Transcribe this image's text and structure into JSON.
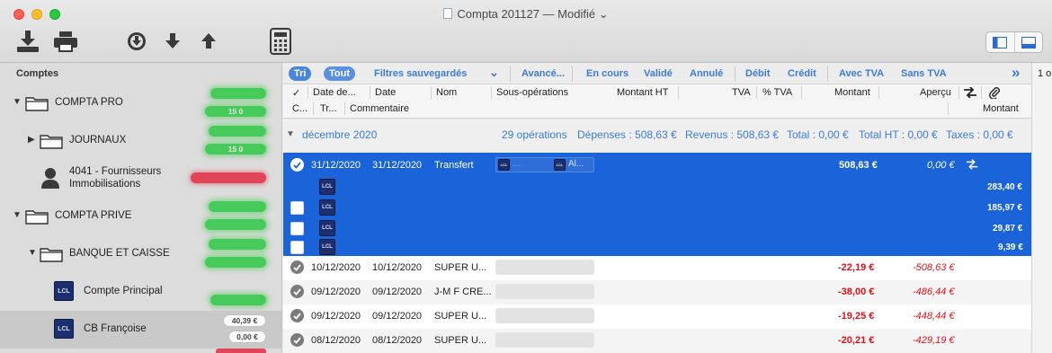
{
  "window": {
    "title": "Compta 201127 — Modifié",
    "title_chevron": "⌄"
  },
  "toolbar": {
    "icons": [
      "download-icon",
      "print-icon",
      "circle-download-icon",
      "arrow-down-icon",
      "arrow-up-icon",
      "calculator-icon"
    ],
    "view_buttons": [
      "sidebar-left-icon",
      "panel-bottom-icon"
    ]
  },
  "sidebar": {
    "title": "Comptes",
    "items": [
      {
        "label": "COMPTA PRO",
        "badges": [
          "",
          "15 0"
        ]
      },
      {
        "label": "JOURNAUX",
        "badges": [
          "",
          "15 0"
        ]
      },
      {
        "label": "4041 - Fournisseurs Immobilisations",
        "badges": [
          ""
        ]
      },
      {
        "label": "COMPTA PRIVE",
        "badges": [
          "",
          ""
        ]
      },
      {
        "label": "BANQUE ET CAISSE",
        "badges": [
          "",
          ""
        ]
      },
      {
        "label": "Compte Principal",
        "badges": [
          ""
        ]
      },
      {
        "label": "CB Françoise",
        "badges": [
          "40,39 €",
          "0,00 €"
        ]
      }
    ],
    "lcl_text": "LCL"
  },
  "filters": {
    "tri": "Tri",
    "tout": "Tout",
    "saved": "Filtres sauvegardés",
    "saved_chevron": "⌄",
    "advanced": "Avancé...",
    "en_cours": "En cours",
    "valide": "Validé",
    "annule": "Annulé",
    "debit": "Débit",
    "credit": "Crédit",
    "avec_tva": "Avec TVA",
    "sans_tva": "Sans TVA",
    "more": "»"
  },
  "columns": {
    "row1": [
      "✓",
      "Date de...",
      "Date",
      "Nom",
      "Sous-opérations",
      "Montant HT",
      "TVA",
      "% TVA",
      "Montant",
      "Aperçu"
    ],
    "row2": [
      "C...",
      "Tr...",
      "Commentaire",
      "Montant"
    ]
  },
  "group": {
    "month": "décembre 2020",
    "count": "29 opérations",
    "depenses": "Dépenses : 508,63 €",
    "revenus": "Revenus : 508,63 €",
    "total": "Total : 0,00 €",
    "total_ht": "Total HT : 0,00 €",
    "taxes": "Taxes : 0,00 €"
  },
  "selected_row": {
    "date1": "31/12/2020",
    "date2": "31/12/2020",
    "name": "Transfert",
    "sub_a": "…",
    "sub_b": "Al...",
    "montant": "508,63 €",
    "apercu": "0,00 €"
  },
  "split_amounts": [
    "283,40 €",
    "185,97 €",
    "29,87 €",
    "9,39 €"
  ],
  "rows": [
    {
      "date1": "10/12/2020",
      "date2": "10/12/2020",
      "name": "SUPER U...",
      "montant": "-22,19 €",
      "apercu": "-508,63 €"
    },
    {
      "date1": "09/12/2020",
      "date2": "09/12/2020",
      "name": "J-M F CRE...",
      "montant": "-38,00 €",
      "apercu": "-486,44 €"
    },
    {
      "date1": "09/12/2020",
      "date2": "09/12/2020",
      "name": "SUPER U...",
      "montant": "-19,25 €",
      "apercu": "-448,44 €"
    },
    {
      "date1": "08/12/2020",
      "date2": "08/12/2020",
      "name": "SUPER U...",
      "montant": "-20,21 €",
      "apercu": "-429,19 €"
    }
  ],
  "right_edge": "1 o"
}
